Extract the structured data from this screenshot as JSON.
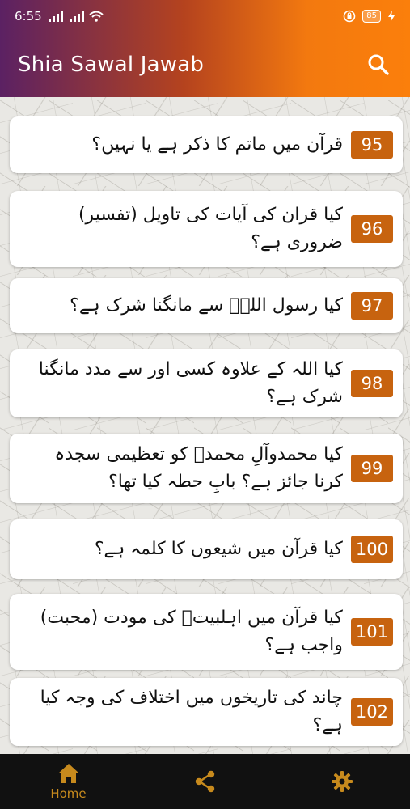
{
  "status": {
    "time": "6:55",
    "battery": "85"
  },
  "toolbar": {
    "title": "Shia Sawal Jawab",
    "search_icon": "search-icon"
  },
  "items": [
    {
      "number": "95",
      "question": "قرآن میں ماتم کا ذکر ہے یا نہیں؟"
    },
    {
      "number": "96",
      "question": "کیا قران کی آیات کی تاویل (تفسیر) ضروری ہے؟"
    },
    {
      "number": "97",
      "question": "کیا رسول اللہؐ سے مانگنا شرک ہے؟"
    },
    {
      "number": "98",
      "question": "کیا اللہ کے علاوہ کسی اور سے مدد مانگنا شرک ہے؟"
    },
    {
      "number": "99",
      "question": "کیا محمدوآلِ محمدؐ کو تعظیمی سجدہ کرنا جائز ہے؟ بابِ حطہ کیا تھا؟"
    },
    {
      "number": "100",
      "question": "کیا قرآن میں شیعوں کا کلمہ ہے؟"
    },
    {
      "number": "101",
      "question": "کیا قرآن میں اہلبیتؑ کی مودت (محبت) واجب ہے؟"
    },
    {
      "number": "102",
      "question": "چاند کی تاریخوں میں اختلاف کی وجہ کیا ہے؟"
    }
  ],
  "bottom_nav": {
    "home_label": "Home",
    "accent": "#c78a1d",
    "icons": [
      "home-icon",
      "share-icon",
      "gear-icon"
    ]
  },
  "colors": {
    "badge": "#c7630f",
    "gradient_start": "#5b2163",
    "gradient_end": "#fb7f0b"
  }
}
